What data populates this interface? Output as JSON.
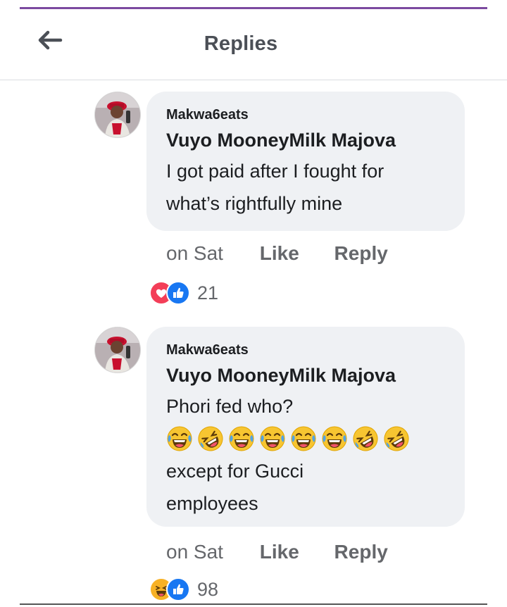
{
  "header": {
    "title": "Replies",
    "back_icon": "left-arrow-icon"
  },
  "colors": {
    "top_rule": "#7b4aa0",
    "bubble": "#eff1f4",
    "muted_text": "#65676b",
    "love_red": "#f33e58",
    "like_blue": "#1877f2",
    "haha_yellow": "#f7b125"
  },
  "replies": [
    {
      "page_name": "Makwa6eats",
      "author": "Vuyo MooneyMilk Majova",
      "lines": [
        "I got paid after I fought for",
        "what’s rightfully mine"
      ],
      "time": "on Sat",
      "like_label": "Like",
      "reply_label": "Reply",
      "reaction_icons": [
        "love-reaction-icon",
        "like-reaction-icon"
      ],
      "reaction_count": "21"
    },
    {
      "page_name": "Makwa6eats",
      "author": "Vuyo MooneyMilk Majova",
      "lines_before_emoji": [
        "Phori fed who?"
      ],
      "emojis": [
        "tears-of-joy",
        "rolling-on-floor-laughing",
        "tears-of-joy",
        "tears-of-joy",
        "tears-of-joy",
        "tears-of-joy",
        "rolling-on-floor-laughing",
        "rolling-on-floor-laughing"
      ],
      "lines_after_emoji": [
        "except for Gucci",
        "employees"
      ],
      "time": "on Sat",
      "like_label": "Like",
      "reply_label": "Reply",
      "reaction_icons": [
        "haha-reaction-icon",
        "like-reaction-icon"
      ],
      "reaction_count": "98"
    }
  ]
}
